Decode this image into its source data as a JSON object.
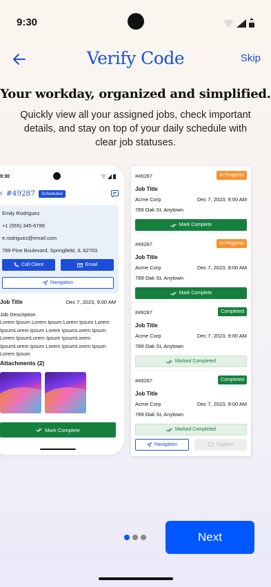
{
  "status_bar": {
    "time": "9:30"
  },
  "header": {
    "title": "Verify Code",
    "skip_label": "Skip"
  },
  "intro": {
    "headline": "Your workday, organized and simplified.",
    "subtitle": "Quickly view all your assigned jobs, check important details, and stay on top of your daily schedule with clear job statuses."
  },
  "phone_preview": {
    "time": "9:30",
    "job_id": "#49287",
    "badge": "Scheduled",
    "client_name": "Emily Rodriguez",
    "phone": "+1 (555) 345-6789",
    "email": "e.rodriguez@email.com",
    "address": "789 Pine Boulevard, Springfield, IL 62703",
    "call_label": "Call Client",
    "email_label": "Email",
    "navigation_label": "Navigation",
    "job_title": "Job Title",
    "job_date": "Dec 7, 2023, 9:00 AM",
    "description_label": "Job Description",
    "description": "Lorem Ipsum Lorem Ipsum Lorem Ipsum Lorem IpsumLorem Ipsum Lorem IpsumLorem Ipsum Lorem IpsumLorem Ipsum IpsumLorem IpsumLorem Ipsum Lorem IpsumLorem Ipsum Lorem Ipsum",
    "attachments_label": "Attachments (2)",
    "mark_complete_label": "Mark Complete"
  },
  "job_cards": [
    {
      "id": "#49287",
      "status": "In Progress",
      "status_color": "#f59331",
      "title": "Job Title",
      "company": "Acme Corp",
      "date": "Dec 7, 2023, 9:00 AM",
      "address": "789 Oak St, Anytown",
      "action_label": "Mark Complete"
    },
    {
      "id": "#49287",
      "status": "In Progress",
      "status_color": "#f59331",
      "title": "Job Title",
      "company": "Acme Corp",
      "date": "Dec 7, 2023, 9:00 AM",
      "address": "789 Oak St, Anytown",
      "action_label": "Mark Complete"
    },
    {
      "id": "#49287",
      "status": "Completed",
      "status_color": "#15803d",
      "title": "Job Title",
      "company": "Acme Corp",
      "date": "Dec 7, 2023, 9:00 AM",
      "address": "789 Oak St, Anytown",
      "action_label": "Marked Completed"
    },
    {
      "id": "#49287",
      "status": "Completed",
      "status_color": "#15803d",
      "title": "Job Title",
      "company": "Acme Corp",
      "date": "Dec 7, 2023, 9:00 AM",
      "address": "789 Oak St, Anytown",
      "action_label": "Marked Completed",
      "navigation_label": "Navigation",
      "support_label": "Support"
    }
  ],
  "footer": {
    "next_label": "Next",
    "page_index": 1,
    "page_count": 3
  },
  "colors": {
    "primary": "#0057ff",
    "accent_blue": "#1d4ed8",
    "success": "#15803d",
    "warning": "#f59331"
  }
}
